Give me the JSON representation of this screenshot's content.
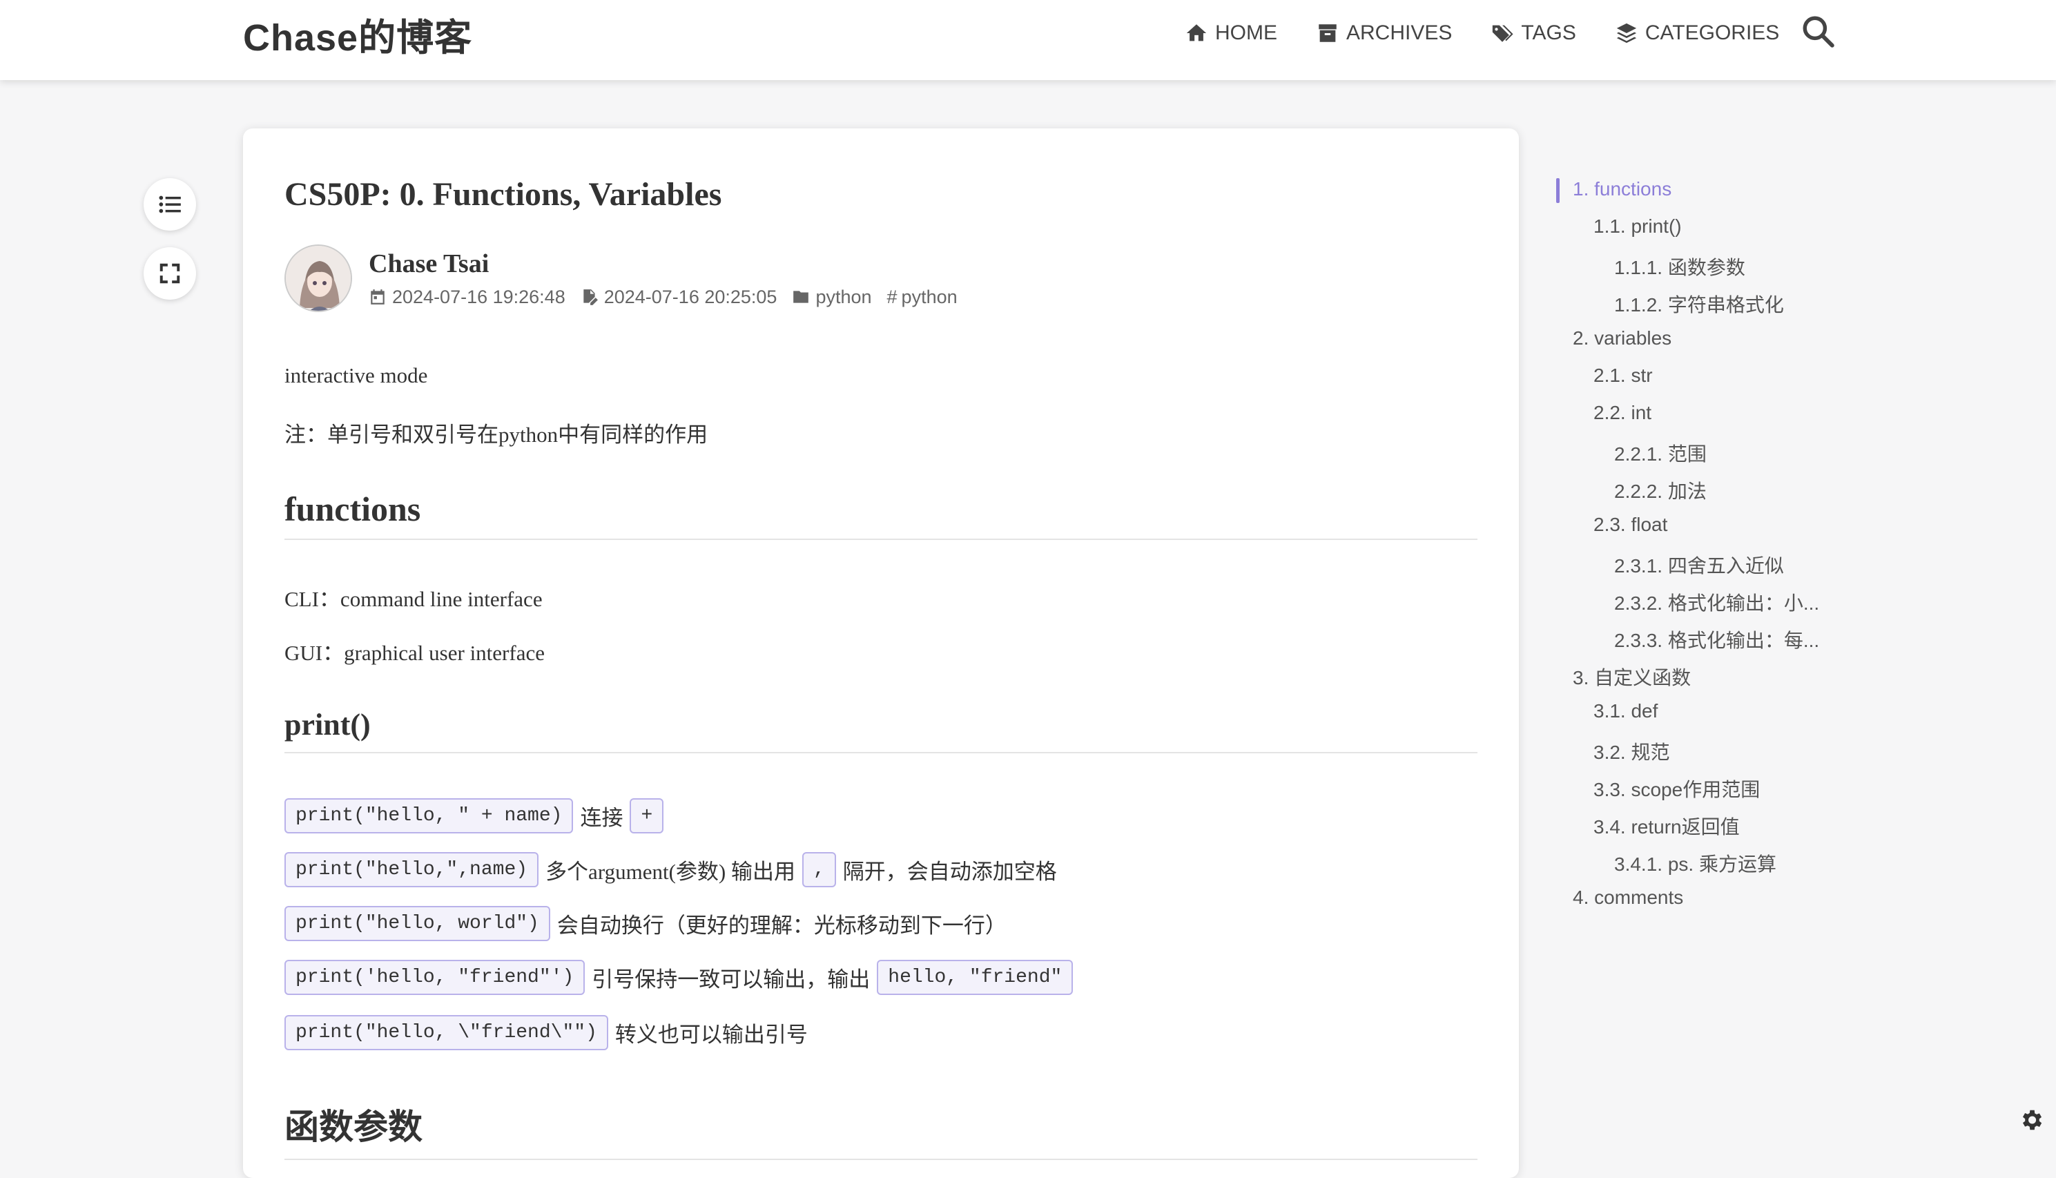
{
  "site": {
    "title": "Chase的博客"
  },
  "nav": {
    "home": "HOME",
    "archives": "ARCHIVES",
    "tags": "TAGS",
    "categories": "CATEGORIES"
  },
  "post": {
    "title": "CS50P: 0. Functions, Variables",
    "author": "Chase Tsai",
    "created": "2024-07-16 19:26:48",
    "updated": "2024-07-16 20:25:05",
    "category": "python",
    "tag": "python"
  },
  "body": {
    "p1": "interactive mode",
    "p2": "注：单引号和双引号在python中有同样的作用",
    "h_functions": "functions",
    "p_cli": "CLI：command line interface",
    "p_gui": "GUI：graphical user interface",
    "h_print": "print()",
    "rows": [
      {
        "code": "print(\"hello, \" + name)",
        "text": "连接",
        "code2": "+",
        "text2": ""
      },
      {
        "code": "print(\"hello,\",name)",
        "text": "多个argument(参数) 输出用",
        "code2": ",",
        "text2": "隔开，会自动添加空格"
      },
      {
        "code": "print(\"hello, world\")",
        "text": "会自动换行（更好的理解：光标移动到下一行）",
        "code2": "",
        "text2": ""
      },
      {
        "code": "print('hello, \"friend\"')",
        "text": "引号保持一致可以输出，输出",
        "code2": "hello, \"friend\"",
        "text2": ""
      },
      {
        "code": "print(\"hello, \\\"friend\\\"\")",
        "text": "转义也可以输出引号",
        "code2": "",
        "text2": ""
      }
    ],
    "h_params": "函数参数"
  },
  "toc": [
    {
      "label": "1. functions",
      "level": 1,
      "active": true
    },
    {
      "label": "1.1. print()",
      "level": 2
    },
    {
      "label": "1.1.1. 函数参数",
      "level": 3
    },
    {
      "label": "1.1.2. 字符串格式化",
      "level": 3
    },
    {
      "label": "2. variables",
      "level": 1
    },
    {
      "label": "2.1. str",
      "level": 2
    },
    {
      "label": "2.2. int",
      "level": 2
    },
    {
      "label": "2.2.1. 范围",
      "level": 3
    },
    {
      "label": "2.2.2. 加法",
      "level": 3
    },
    {
      "label": "2.3. float",
      "level": 2
    },
    {
      "label": "2.3.1. 四舍五入近似",
      "level": 3
    },
    {
      "label": "2.3.2. 格式化输出：小...",
      "level": 3
    },
    {
      "label": "2.3.3. 格式化输出：每...",
      "level": 3
    },
    {
      "label": "3. 自定义函数",
      "level": 1
    },
    {
      "label": "3.1. def",
      "level": 2
    },
    {
      "label": "3.2. 规范",
      "level": 2
    },
    {
      "label": "3.3. scope作用范围",
      "level": 2
    },
    {
      "label": "3.4. return返回值",
      "level": 2
    },
    {
      "label": "3.4.1. ps. 乘方运算",
      "level": 3
    },
    {
      "label": "4. comments",
      "level": 1
    }
  ],
  "colors": {
    "accent": "#8c7ed8",
    "code_border": "#b9b2ea",
    "code_bg": "#f3f2fb"
  }
}
